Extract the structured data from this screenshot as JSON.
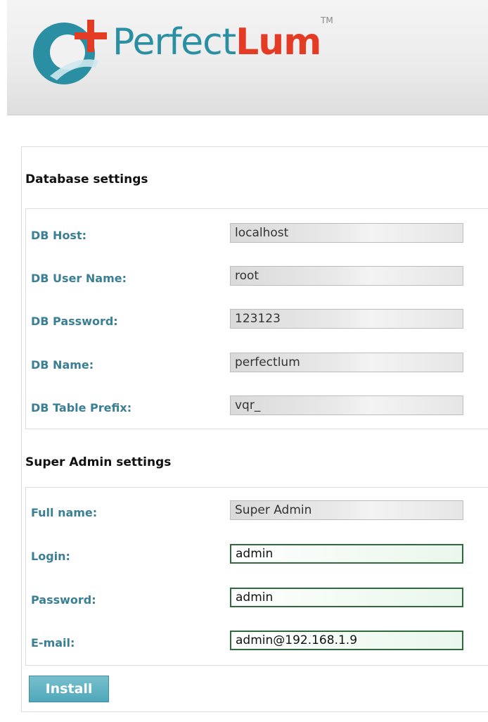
{
  "header": {
    "logo_part1": "Perfect",
    "logo_part2": "Lum",
    "logo_tm": "TM",
    "brand_colors": {
      "teal": "#2b8fa3",
      "red": "#e43b24"
    }
  },
  "database": {
    "title": "Database settings",
    "fields": [
      {
        "label": "DB Host:",
        "value": "localhost"
      },
      {
        "label": "DB User Name:",
        "value": "root"
      },
      {
        "label": "DB Password:",
        "value": "123123"
      },
      {
        "label": "DB Name:",
        "value": "perfectlum"
      },
      {
        "label": "DB Table Prefix:",
        "value": "vqr_"
      }
    ]
  },
  "admin": {
    "title": "Super Admin settings",
    "fields": [
      {
        "label": "Full name:",
        "value": "Super Admin"
      },
      {
        "label": "Login:",
        "value": "admin"
      },
      {
        "label": "Password:",
        "value": "admin"
      },
      {
        "label": "E-mail:",
        "value": "admin@192.168.1.9"
      }
    ]
  },
  "install_label": "Install"
}
